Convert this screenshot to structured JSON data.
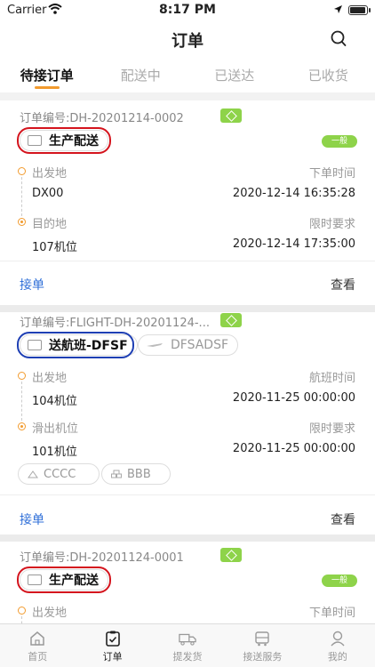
{
  "status_bar": {
    "carrier": "Carrier",
    "time": "8:17 PM"
  },
  "nav": {
    "title": "订单"
  },
  "tabs": [
    {
      "label": "待接订单",
      "active": true
    },
    {
      "label": "配送中",
      "active": false
    },
    {
      "label": "已送达",
      "active": false
    },
    {
      "label": "已收货",
      "active": false
    }
  ],
  "orders": [
    {
      "order_no": "订单编号:DH-20201214-0002",
      "service": "生产配送",
      "level": "一般",
      "from_label": "出发地",
      "from_value": "DX00",
      "time1_label": "下单时间",
      "time1_value": "2020-12-14 16:35:28",
      "to_label": "目的地",
      "to_value": "107机位",
      "time2_label": "限时要求",
      "time2_value": "2020-12-14 17:35:00",
      "accept_label": "接单",
      "view_label": "查看"
    },
    {
      "order_no": "订单编号:FLIGHT-DH-20201124-...",
      "service": "送航班-DFSF",
      "flight": "DFSADSF",
      "from_label": "出发地",
      "from_value": "104机位",
      "time1_label": "航班时间",
      "time1_value": "2020-11-25 00:00:00",
      "to_label": "滑出机位",
      "to_value": "101机位",
      "time2_label": "限时要求",
      "time2_value": "2020-11-25 00:00:00",
      "chips": [
        "CCCC",
        "BBB"
      ],
      "accept_label": "接单",
      "view_label": "查看"
    },
    {
      "order_no": "订单编号:DH-20201124-0001",
      "service": "生产配送",
      "level": "一般",
      "from_label": "出发地",
      "time1_label": "下单时间"
    }
  ],
  "tabbar": [
    {
      "label": "首页",
      "icon": "home-icon",
      "active": false
    },
    {
      "label": "订单",
      "icon": "order-icon",
      "active": true
    },
    {
      "label": "提发货",
      "icon": "truck-icon",
      "active": false
    },
    {
      "label": "接送服务",
      "icon": "bus-icon",
      "active": false
    },
    {
      "label": "我的",
      "icon": "user-icon",
      "active": false
    }
  ],
  "colors": {
    "accent": "#f29b2e",
    "link": "#2f6fd8",
    "level_bg": "#8ed34a",
    "annotation_red": "#d4141d",
    "annotation_blue": "#1e3fb4"
  }
}
